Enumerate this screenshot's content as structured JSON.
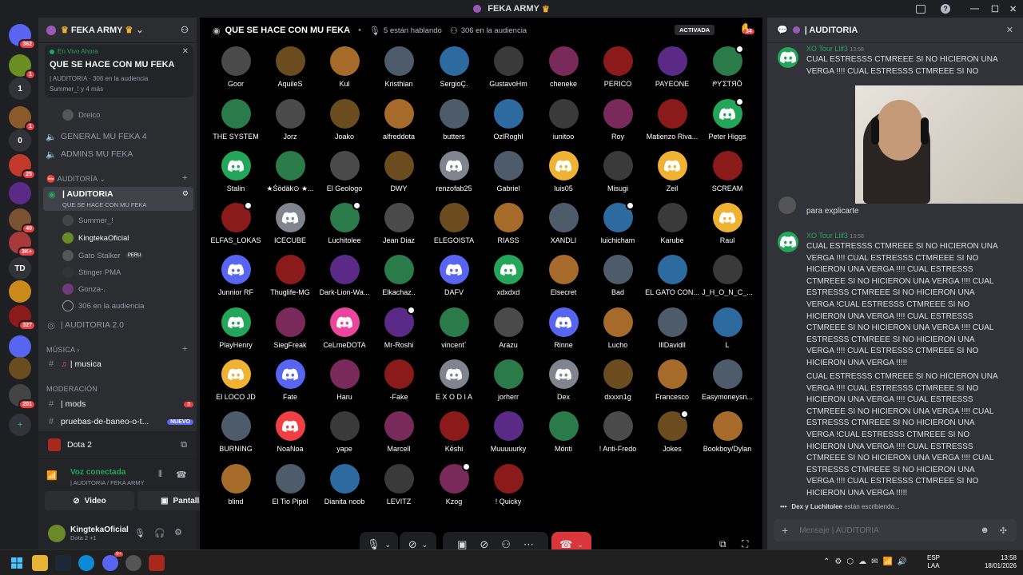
{
  "window": {
    "title": "FEKA ARMY"
  },
  "rail": {
    "servers": [
      {
        "badge": "362",
        "color": "#5865f2"
      },
      {
        "badge": "1",
        "color": "#6b8e23"
      },
      {
        "badge": "",
        "text": "1",
        "color": "#313338"
      },
      {
        "badge": "1",
        "color": "#8b5a2b"
      },
      {
        "badge": "",
        "text": "0",
        "color": "#313338"
      },
      {
        "badge": "25",
        "color": "#c0392b"
      },
      {
        "badge": "",
        "color": "#5b2a86"
      },
      {
        "badge": "40",
        "color": "#7a5230"
      },
      {
        "badge": "3K+",
        "color": "#a63a3a"
      },
      {
        "badge": "",
        "text": "TD",
        "color": "#313338"
      },
      {
        "badge": "",
        "color": "#c98a1b"
      },
      {
        "badge": "327",
        "color": "#8b1a1a"
      },
      {
        "badge": "",
        "color": "#5865f2"
      },
      {
        "badge": "",
        "color": "#6b4c1f"
      },
      {
        "badge": "201",
        "color": "#444"
      }
    ]
  },
  "sidebar": {
    "server_name": "FEKA ARMY",
    "live_label": "En Vivo Ahora",
    "live_title": "QUE SE HACE CON MU FEKA",
    "live_channel": "| AUDITORIA",
    "live_audience": "306 en la audiencia",
    "live_people": "Summer_! y 4 más",
    "dreico": "Dreico",
    "voice1": "GENERAL MU FEKA 4",
    "voice2": "ADMINS MU FEKA",
    "cat_auditoria": "AUDITORÍA",
    "stage_name": "| AUDITORIA",
    "stage_topic": "QUE SE HACE CON MU FEKA",
    "users": [
      "Summer_!",
      "KingtekaOficial",
      "Gato Stalker",
      "Stinger PMA",
      "Gonza-."
    ],
    "peru_tag": "PERU",
    "stage_audience": "306 en la audiencia",
    "stage2": "| AUDITORIA 2.0",
    "cat_musica": "MÚSICA",
    "musica": "| musica",
    "cat_moderacion": "MODERACIÓN",
    "mods": "| mods",
    "mods_badge": "3",
    "pruebas": "pruebas-de-baneo-o-t...",
    "nuevo": "NUEVO"
  },
  "activity": {
    "game": "Dota 2"
  },
  "voice_panel": {
    "status": "Voz conectada",
    "location": "| AUDITORIA / FEKA ARMY",
    "video": "Video",
    "screen": "Pantalla"
  },
  "user_panel": {
    "name": "KingtekaOficial",
    "status": "Dota 2 +1"
  },
  "stage": {
    "title": "QUE SE HACE CON MU FEKA",
    "speaking": "5 están hablando",
    "audience": "306 en la audiencia",
    "activated": "ACTIVADA",
    "hand_badge": "34"
  },
  "audience_rows": [
    [
      "Goor",
      "AquileS",
      "Kul",
      "Kristhian",
      "SergioÇ.",
      "GustavoHm",
      "cheneke",
      "PERICO",
      "PAYEONE",
      "ᖘƳΣƬЯÔ"
    ],
    [
      "THE SYSTEM",
      "Jorz",
      "Joako",
      "alfreddota",
      "butters",
      "OzlRoghl",
      "iunitoo",
      "Roy",
      "Matienzo Riva...",
      "Peter Higgs"
    ],
    [
      "Stalin",
      "★Śödäk⊙ ★...",
      "El Geologo",
      "DWY",
      "renzofab25",
      "Gabriel",
      "luis05",
      "Misugi",
      "Zeil",
      "SCREAM"
    ],
    [
      "ELFAS_LOKAS",
      "ICECUBE",
      "Luchitolee",
      "Jean Diaz",
      "ELEGOISTA",
      "RIASS",
      "XANDLI",
      "luichicham",
      "Karube",
      "Raul"
    ],
    [
      "Junnior RF",
      "Thuglife-MG",
      "Dark-Lion-Wa...",
      "Elkachaz..",
      "DAFV",
      "xdxdxd",
      "Elsecret",
      "Bad",
      "EL GATO CON...",
      "J_H_O_N_C_..."
    ],
    [
      "PlayHenry",
      "SiegFreak",
      "CeLmeDOTA",
      "Mr-Roshi",
      "vincent`",
      "Arazu",
      "Rinne",
      "Lucho",
      "lIlDavidll",
      "L"
    ],
    [
      "El LOCO JD",
      "Fate",
      "Haru",
      "-Fake",
      "E X O D I A",
      "jorherr",
      "Dex",
      "dxxxn1g",
      "Francesco",
      "Easymoneysn..."
    ],
    [
      "BURNING",
      "NoaNoa",
      "yape",
      "Marcell",
      "Kēshi",
      "Muuuuurky",
      "Mónti",
      "! Anti-Fredo",
      "Jokes",
      "Bookboy/Dylan"
    ],
    [
      "blind",
      "El Tio Pipol",
      "Dianita noob",
      "LEVITZ",
      "Kzog",
      "! Quicky"
    ]
  ],
  "chat": {
    "header": "| AUDITORIA",
    "msg1_author": "XO Tour Llif3",
    "msg1_time": "13:58",
    "msg1_text": "CUAL ESTRESSS CTMREEE SI NO HICIERON UNA VERGA !!!! CUAL ESTRESSS CTMREEE SI NO HICIERON UNA VERGA !!!! CUAL ESTRESSS",
    "msg2_text": "para explicarte",
    "msg3_author": "XO Tour Llif3",
    "msg3_time": "13:58",
    "msg3_text": "CUAL ESTRESSS CTMREEE SI NO HICIERON UNA VERGA !!!! CUAL ESTRESSS CTMREEE SI NO HICIERON UNA VERGA !!!!  CUAL ESTRESSS CTMREEE SI NO HICIERON UNA VERGA !!!! CUAL ESTRESSS CTMREEE SI NO HICIERON UNA VERGA !CUAL ESTRESSS CTMREEE SI NO HICIERON UNA VERGA !!!! CUAL ESTRESSS CTMREEE SI NO HICIERON UNA VERGA !!!!  CUAL ESTRESSS CTMREEE SI NO HICIERON UNA VERGA !!!! CUAL ESTRESSS CTMREEE SI NO HICIERON UNA VERGA !!!!!",
    "msg4_text": "CUAL ESTRESSS CTMREEE SI NO HICIERON UNA VERGA !!!! CUAL ESTRESSS CTMREEE SI NO HICIERON UNA VERGA !!!!  CUAL ESTRESSS CTMREEE SI NO HICIERON UNA VERGA !!!! CUAL ESTRESSS CTMREEE SI NO HICIERON UNA VERGA !CUAL ESTRESSS CTMREEE SI NO HICIERON UNA VERGA !!!! CUAL ESTRESSS CTMREEE SI NO HICIERON UNA VERGA !!!!  CUAL ESTRESSS CTMREEE SI NO HICIERON UNA VERGA !!!! CUAL ESTRESSS CTMREEE SI NO HICIERON UNA VERGA !!!!!",
    "typing_names": "Dex y Luchitolee",
    "typing_suffix": "están escribiendo...",
    "input_placeholder": "Mensaje   | AUDITORIA"
  },
  "taskbar": {
    "lang": "ESP",
    "lang2": "LAA",
    "time": "13:58",
    "date": "18/01/2026",
    "discord_badge": "9+"
  }
}
